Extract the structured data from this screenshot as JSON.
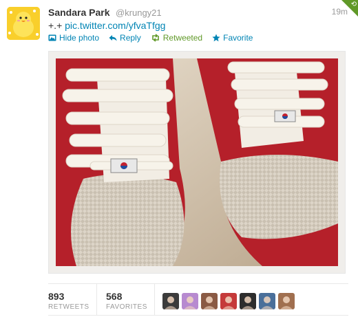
{
  "tweet": {
    "author_name": "Sandara Park",
    "author_handle": "@krungy21",
    "time": "19m",
    "text_prefix": "+.+",
    "link": "pic.twitter.com/yfvaTfgg"
  },
  "actions": {
    "hide_photo": "Hide photo",
    "reply": "Reply",
    "retweeted": "Retweeted",
    "favorite": "Favorite"
  },
  "stats": {
    "retweets_count": "893",
    "retweets_label": "RETWEETS",
    "favorites_count": "568",
    "favorites_label": "FAVORITES"
  },
  "favoriters": [
    {
      "icon": "user-avatar",
      "color": "#3b3b3b"
    },
    {
      "icon": "user-avatar",
      "color": "#b78ad0"
    },
    {
      "icon": "user-avatar",
      "color": "#8a5a44"
    },
    {
      "icon": "user-avatar",
      "color": "#c53a3a"
    },
    {
      "icon": "user-avatar",
      "color": "#2d2d2d"
    },
    {
      "icon": "user-avatar",
      "color": "#4a6f9a"
    },
    {
      "icon": "user-avatar",
      "color": "#a06f4f"
    }
  ],
  "colors": {
    "link": "#0084b4",
    "retweet_green": "#609928",
    "muted": "#999999"
  }
}
